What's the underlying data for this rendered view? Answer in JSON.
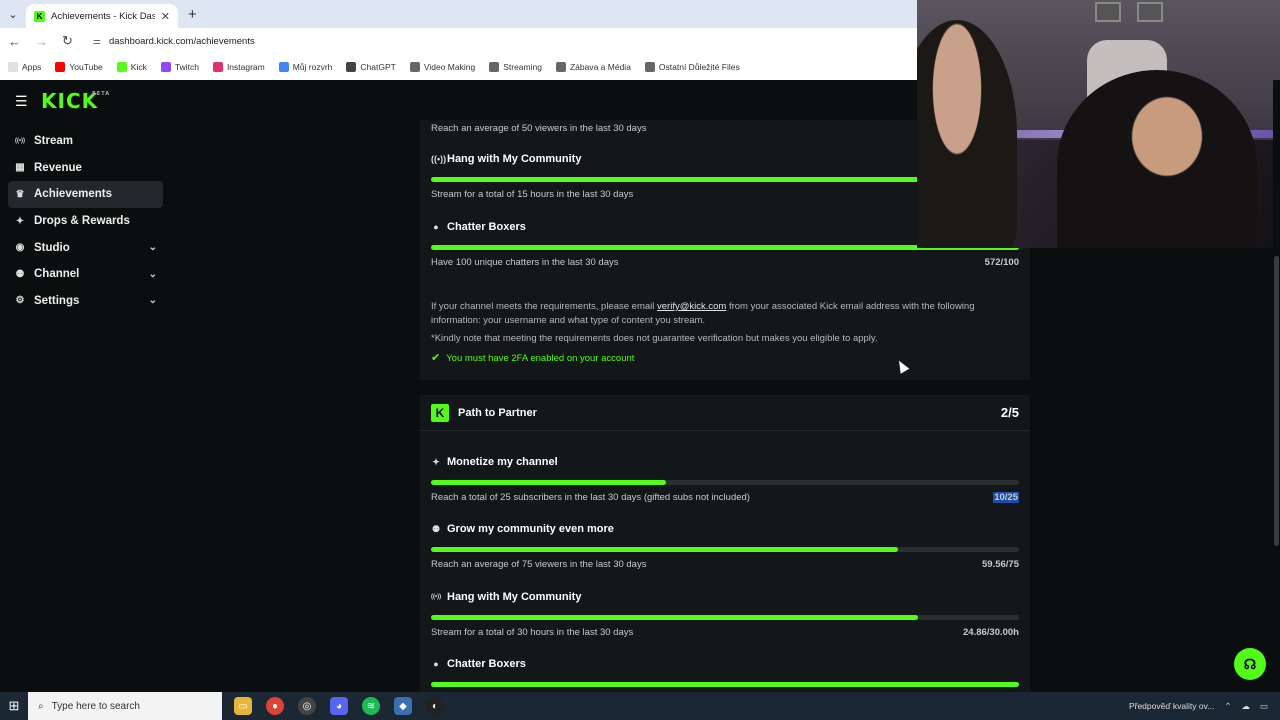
{
  "browser": {
    "tab_title": "Achievements - Kick Dashboard",
    "url": "dashboard.kick.com/achievements",
    "bookmarks": [
      {
        "label": "Apps",
        "color": "#e0e0e0"
      },
      {
        "label": "YouTube",
        "color": "#ff0000"
      },
      {
        "label": "Kick",
        "color": "#53fc18"
      },
      {
        "label": "Twitch",
        "color": "#9146ff"
      },
      {
        "label": "Instagram",
        "color": "#e1306c"
      },
      {
        "label": "Můj rozvrh",
        "color": "#4285f4"
      },
      {
        "label": "ChatGPT",
        "color": "#444444"
      },
      {
        "label": "Video Making",
        "color": "#666666"
      },
      {
        "label": "Streaming",
        "color": "#666666"
      },
      {
        "label": "Zábava a Média",
        "color": "#666666"
      },
      {
        "label": "Ostatní Důležité Files",
        "color": "#666666"
      }
    ]
  },
  "app": {
    "logo": "KICK",
    "logo_badge": "BETA",
    "accent": "#53fc18"
  },
  "sidebar": {
    "items": [
      {
        "label": "Stream",
        "icon": "broadcast-icon",
        "glyph": "((•))",
        "has_chevron": false,
        "active": false
      },
      {
        "label": "Revenue",
        "icon": "revenue-icon",
        "glyph": "▦",
        "has_chevron": false,
        "active": false
      },
      {
        "label": "Achievements",
        "icon": "trophy-icon",
        "glyph": "♛",
        "has_chevron": false,
        "active": true
      },
      {
        "label": "Drops & Rewards",
        "icon": "gift-icon",
        "glyph": "✦",
        "has_chevron": false,
        "active": false
      },
      {
        "label": "Studio",
        "icon": "studio-icon",
        "glyph": "◉",
        "has_chevron": true,
        "active": false
      },
      {
        "label": "Channel",
        "icon": "users-icon",
        "glyph": "⚉",
        "has_chevron": true,
        "active": false
      },
      {
        "label": "Settings",
        "icon": "gear-icon",
        "glyph": "⚙",
        "has_chevron": true,
        "active": false
      }
    ]
  },
  "verification": {
    "top_desc": "Reach an average of 50 viewers in the last 30 days",
    "items": [
      {
        "title": "Hang with My Community",
        "desc": "Stream for a total of 15 hours in the last 30 days",
        "value": "",
        "progress": 1.0
      },
      {
        "title": "Chatter Boxers",
        "desc": "Have 100 unique chatters in the last 30 days",
        "value": "572/100",
        "progress": 1.0
      }
    ],
    "info_prefix": "If your channel meets the requirements, please email ",
    "info_email": "verify@kick.com",
    "info_suffix": " from your associated Kick email address with the following information: your username and what type of content you stream.",
    "note": "*Kindly note that meeting the requirements does not guarantee verification but makes you eligible to apply.",
    "requirement": "You must have 2FA enabled on your account"
  },
  "partner": {
    "title": "Path to Partner",
    "count": "2/5",
    "items": [
      {
        "title": "Monetize my channel",
        "icon": "sparkle-icon",
        "desc": "Reach a total of 25 subscribers in the last 30 days (gifted subs not included)",
        "value": "10/25",
        "progress": 0.4
      },
      {
        "title": "Grow my community even more",
        "icon": "users-icon",
        "desc": "Reach an average of 75 viewers in the last 30 days",
        "value": "59.56/75",
        "progress": 0.794
      },
      {
        "title": "Hang with My Community",
        "icon": "broadcast-icon",
        "desc": "Stream for a total of 30 hours in the last 30 days",
        "value": "24.86/30.00h",
        "progress": 0.829
      },
      {
        "title": "Chatter Boxers",
        "icon": "chat-icon",
        "desc": "",
        "value": "",
        "progress": 1.0
      }
    ]
  },
  "taskbar": {
    "search_placeholder": "Type here to search",
    "notification": "Předpověď kvality ov..."
  }
}
